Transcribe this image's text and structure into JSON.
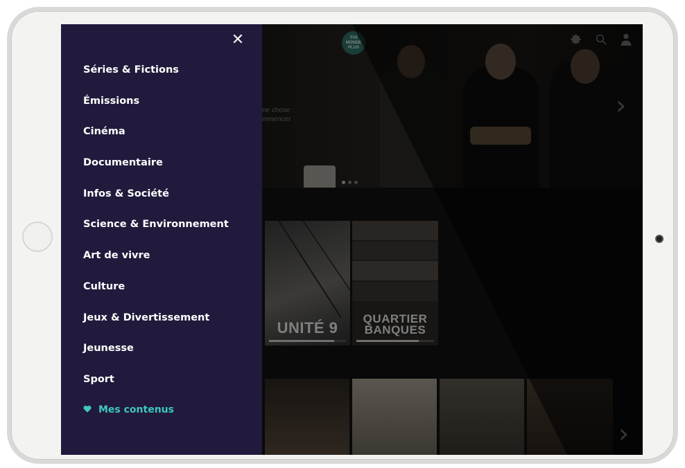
{
  "menu": {
    "close_icon": "close-icon",
    "items": [
      {
        "label": "Séries & Fictions"
      },
      {
        "label": "Émissions"
      },
      {
        "label": "Cinéma"
      },
      {
        "label": "Documentaire"
      },
      {
        "label": "Infos & Société"
      },
      {
        "label": "Science & Environnement"
      },
      {
        "label": "Art de vivre"
      },
      {
        "label": "Culture"
      },
      {
        "label": "Jeux & Divertissement"
      },
      {
        "label": "Jeunesse"
      },
      {
        "label": "Sport"
      }
    ],
    "favorites": {
      "icon": "heart-icon",
      "label": "Mes contenus"
    }
  },
  "header": {
    "logo_text": "TV5 MONDE PLUS",
    "icons": [
      "gear-icon",
      "search-icon",
      "user-icon"
    ]
  },
  "hero": {
    "teaser_line1": "ne chose :",
    "teaser_line2": "mmencer"
  },
  "rows": {
    "row1": [
      {
        "title": "UNITÉ 9",
        "progress": 0.85
      },
      {
        "title_line1": "QUARTIER",
        "title_line2": "BANQUES",
        "progress": 0.8
      }
    ]
  },
  "colors": {
    "menu_bg": "#211a3c",
    "accent": "#3fc7c0"
  }
}
